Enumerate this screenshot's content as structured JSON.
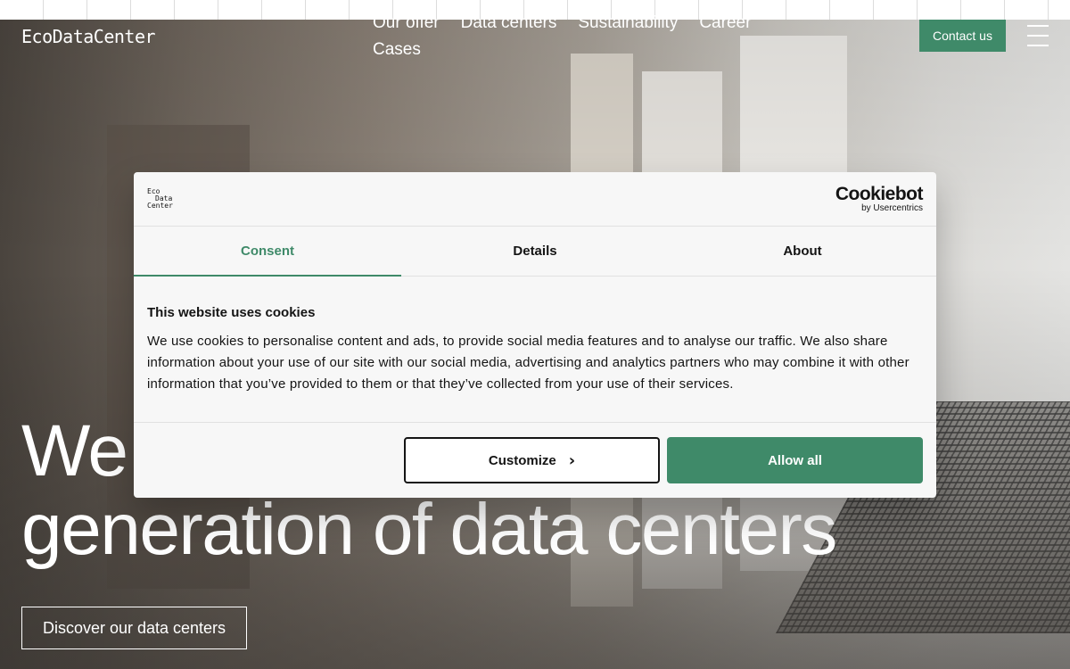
{
  "site": {
    "logo": "EcoDataCenter",
    "nav": [
      "Our offer",
      "Data centers",
      "Sustainability",
      "Career",
      "Cases"
    ],
    "contact_label": "Contact us",
    "headline_line1": "We",
    "headline_line2": "generation of data centers",
    "cta_label": "Discover our data centers"
  },
  "cookie_dialog": {
    "mini_logo": [
      "Eco",
      "Data",
      "Center"
    ],
    "brand": "Cookiebot",
    "brand_sub": "by Usercentrics",
    "tabs": [
      "Consent",
      "Details",
      "About"
    ],
    "active_tab": "Consent",
    "title": "This website uses cookies",
    "text": "We use cookies to personalise content and ads, to provide social media features and to analyse our traffic. We also share information about your use of our site with our social media, advertising and analytics partners who may combine it with other information that you’ve provided to them or that they’ve collected from your use of their services.",
    "customize_label": "Customize",
    "allow_label": "Allow all"
  },
  "colors": {
    "accent": "#3f8a69",
    "text_dark": "#141414",
    "dialog_bg": "#f7f7f7"
  }
}
